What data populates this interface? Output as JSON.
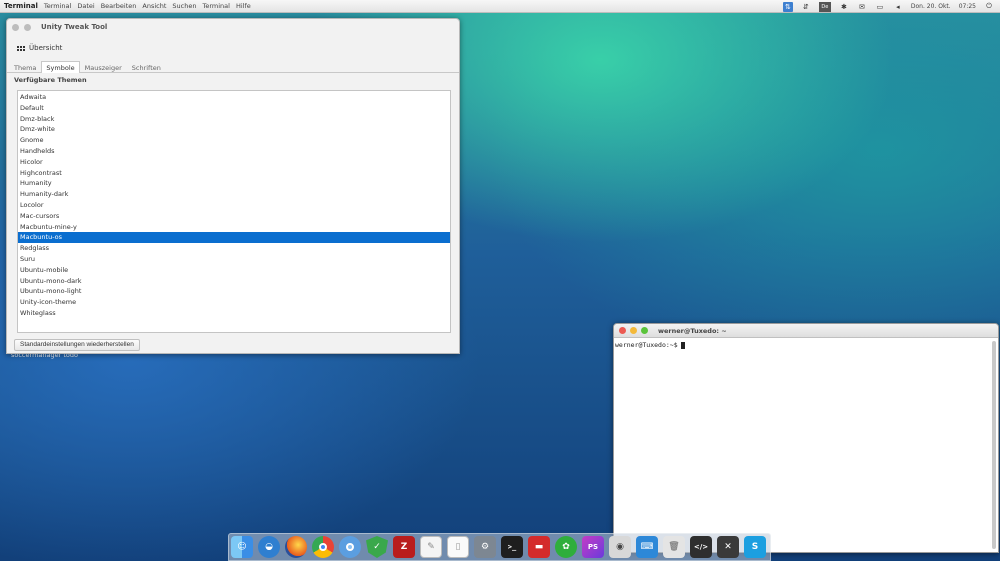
{
  "menubar": {
    "app_name": "Terminal",
    "items": [
      "Terminal",
      "Datei",
      "Bearbeiten",
      "Ansicht",
      "Suchen",
      "Terminal",
      "Hilfe"
    ],
    "datetime": "Don. 20. Okt.",
    "time": "07:25",
    "tray_icons": [
      "accessibility-icon",
      "network-icon",
      "keyboard-layout-icon",
      "bluetooth-icon",
      "mail-icon",
      "battery-icon",
      "volume-icon",
      "settings-icon"
    ]
  },
  "desktop": {
    "label": "soccermanager todo"
  },
  "tweak_window": {
    "title": "Unity Tweak Tool",
    "overview_label": "Übersicht",
    "tabs": [
      "Thema",
      "Symbole",
      "Mauszeiger",
      "Schriften"
    ],
    "active_tab": 1,
    "section_title": "Verfügbare Themen",
    "themes": [
      "Adwaita",
      "Default",
      "Dmz-black",
      "Dmz-white",
      "Gnome",
      "Handhelds",
      "Hicolor",
      "Highcontrast",
      "Humanity",
      "Humanity-dark",
      "Locolor",
      "Mac-cursors",
      "Macbuntu-mine-y",
      "Macbuntu-os",
      "Redglass",
      "Suru",
      "Ubuntu-mobile",
      "Ubuntu-mono-dark",
      "Ubuntu-mono-light",
      "Unity-icon-theme",
      "Whiteglass"
    ],
    "selected_theme": "Macbuntu-os",
    "reset_button": "Standardeinstellungen wiederherstellen"
  },
  "terminal": {
    "title": "werner@Tuxedo: ~",
    "prompt": "werner@Tuxedo:~$"
  },
  "dock": {
    "icons": [
      "finder-icon",
      "shotwell-icon",
      "firefox-icon",
      "chrome-icon",
      "chromium-icon",
      "security-shield-icon",
      "filezilla-icon",
      "text-editor-icon",
      "document-icon",
      "system-settings-icon",
      "terminal-icon",
      "folder-icon",
      "scrum-icon",
      "phpstorm-icon",
      "camera-icon",
      "keyboard-icon",
      "trash-icon",
      "code-editor-icon",
      "utility-icon",
      "skype-icon"
    ]
  },
  "colors": {
    "selection": "#0a6ecf",
    "menubar_bg": "#ececec"
  }
}
